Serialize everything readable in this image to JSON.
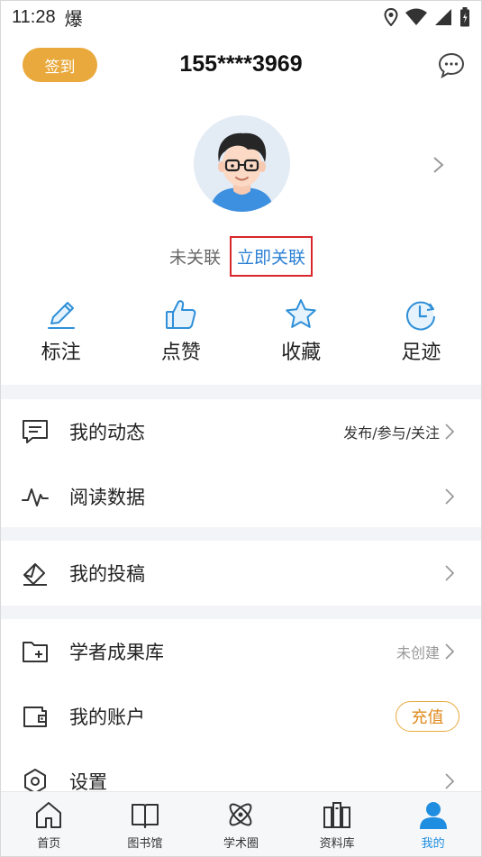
{
  "status_bar": {
    "time": "11:28",
    "weather": "爆"
  },
  "header": {
    "sign_in_label": "签到",
    "phone": "155****3969"
  },
  "profile": {
    "unlinked_label": "未关联",
    "link_now_label": "立即关联"
  },
  "quick_actions": [
    {
      "label": "标注",
      "icon": "pencil-icon"
    },
    {
      "label": "点赞",
      "icon": "thumbs-up-icon"
    },
    {
      "label": "收藏",
      "icon": "star-icon"
    },
    {
      "label": "足迹",
      "icon": "history-clock-icon"
    }
  ],
  "menu": {
    "my_activity": {
      "label": "我的动态",
      "value": "发布/参与/关注"
    },
    "reading_data": {
      "label": "阅读数据"
    },
    "my_submissions": {
      "label": "我的投稿"
    },
    "scholar_library": {
      "label": "学者成果库",
      "value": "未创建"
    },
    "my_account": {
      "label": "我的账户",
      "action": "充值"
    },
    "settings": {
      "label": "设置"
    }
  },
  "tabbar": [
    {
      "label": "首页",
      "icon": "home-icon"
    },
    {
      "label": "图书馆",
      "icon": "book-icon"
    },
    {
      "label": "学术圈",
      "icon": "atom-icon"
    },
    {
      "label": "资料库",
      "icon": "library-icon"
    },
    {
      "label": "我的",
      "icon": "person-icon",
      "active": true
    }
  ],
  "colors": {
    "accent": "#1f8ee0",
    "sign_button": "#e9a93c",
    "link": "#2a7fd4",
    "highlight_border": "#d8262a"
  }
}
